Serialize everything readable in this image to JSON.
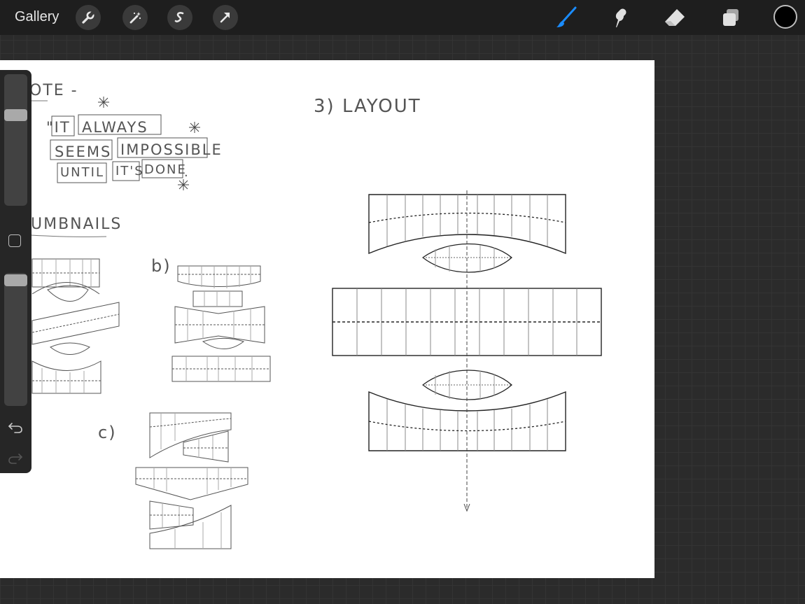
{
  "toolbar": {
    "gallery_label": "Gallery",
    "left_tools": [
      "wrench-icon",
      "magic-wand-icon",
      "selection-icon",
      "transform-arrow-icon"
    ],
    "right_tools": [
      "brush-icon",
      "smudge-icon",
      "eraser-icon",
      "layers-icon"
    ],
    "active_tool": "brush",
    "active_color": "#1a8cff",
    "current_color": "#000000"
  },
  "sidebar": {
    "brush_size_level": 0.71,
    "opacity_level": 1.0,
    "icons": [
      "modify-square-icon",
      "undo-icon",
      "redo-icon"
    ]
  },
  "canvas": {
    "quote_heading": "OTE -",
    "quote_words": [
      "\"IT",
      "ALWAYS",
      "SEEMS",
      "IMPOSSIBLE",
      "UNTIL",
      "IT'S",
      "DONE",
      "."
    ],
    "thumbnails_heading": "UMBNAILS",
    "label_b": "b)",
    "label_c": "c)",
    "layout_heading": "3) LAYOUT"
  }
}
